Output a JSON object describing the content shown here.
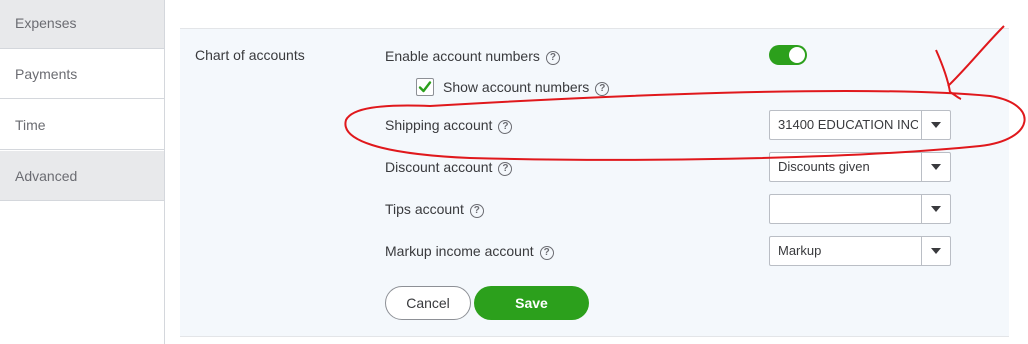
{
  "sidebar": {
    "items": [
      {
        "label": "Expenses"
      },
      {
        "label": "Payments"
      },
      {
        "label": "Time"
      },
      {
        "label": "Advanced"
      }
    ]
  },
  "section": {
    "title": "Chart of accounts",
    "enable_account_numbers": {
      "label": "Enable account numbers",
      "help": "?",
      "enabled": true
    },
    "show_account_numbers": {
      "label": "Show account numbers",
      "help": "?",
      "checked": true
    },
    "shipping_account": {
      "label": "Shipping account",
      "help": "?",
      "value": "31400 EDUCATION INC"
    },
    "discount_account": {
      "label": "Discount account",
      "help": "?",
      "value": "Discounts given"
    },
    "tips_account": {
      "label": "Tips account",
      "help": "?",
      "value": ""
    },
    "markup_income_account": {
      "label": "Markup income account",
      "help": "?",
      "value": "Markup"
    }
  },
  "buttons": {
    "cancel_label": "Cancel",
    "save_label": "Save"
  },
  "colors": {
    "accent_green": "#2ca01c",
    "annotation_red": "#e0181c"
  }
}
